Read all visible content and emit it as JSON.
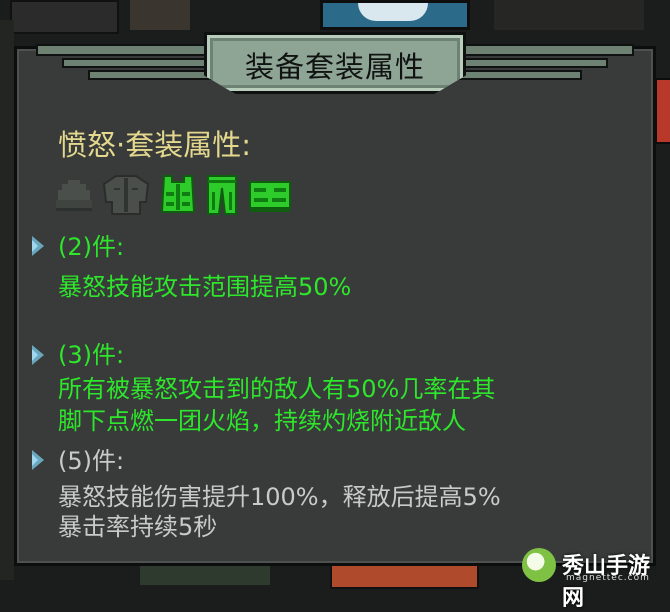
{
  "tooltip": {
    "title": "装备套装属性",
    "set_name": "愤怒·套装属性:",
    "equipment": [
      {
        "name": "helmet-icon",
        "color": "#4a4f4c",
        "active": false
      },
      {
        "name": "armor-icon",
        "color": "#4a4f4c",
        "active": false
      },
      {
        "name": "vest-icon",
        "color": "#2ecc2b",
        "active": true
      },
      {
        "name": "pants-icon",
        "color": "#2ecc2b",
        "active": true
      },
      {
        "name": "boots-icon",
        "color": "#2ecc2b",
        "active": true
      }
    ],
    "bonuses": [
      {
        "tier": "(2)件:",
        "lines": [
          "暴怒技能攻击范围提高50%"
        ],
        "active": true
      },
      {
        "tier": "(3)件:",
        "lines": [
          "所有被暴怒攻击到的敌人有50%几率在其",
          "脚下点燃一团火焰，持续灼烧附近敌人"
        ],
        "active": true
      },
      {
        "tier": "(5)件:",
        "lines": [
          "暴怒技能伤害提升100%，释放后提高5%",
          "暴击率持续5秒"
        ],
        "active": false
      }
    ],
    "colors": {
      "active": "#2ee62b",
      "inactive": "#c8cbc9",
      "set_name": "#e4d88e",
      "banner": "#8ea595",
      "panel": "#383b3a"
    }
  },
  "watermark": {
    "text": "秀山手游网",
    "sub": "magnettec.com"
  }
}
